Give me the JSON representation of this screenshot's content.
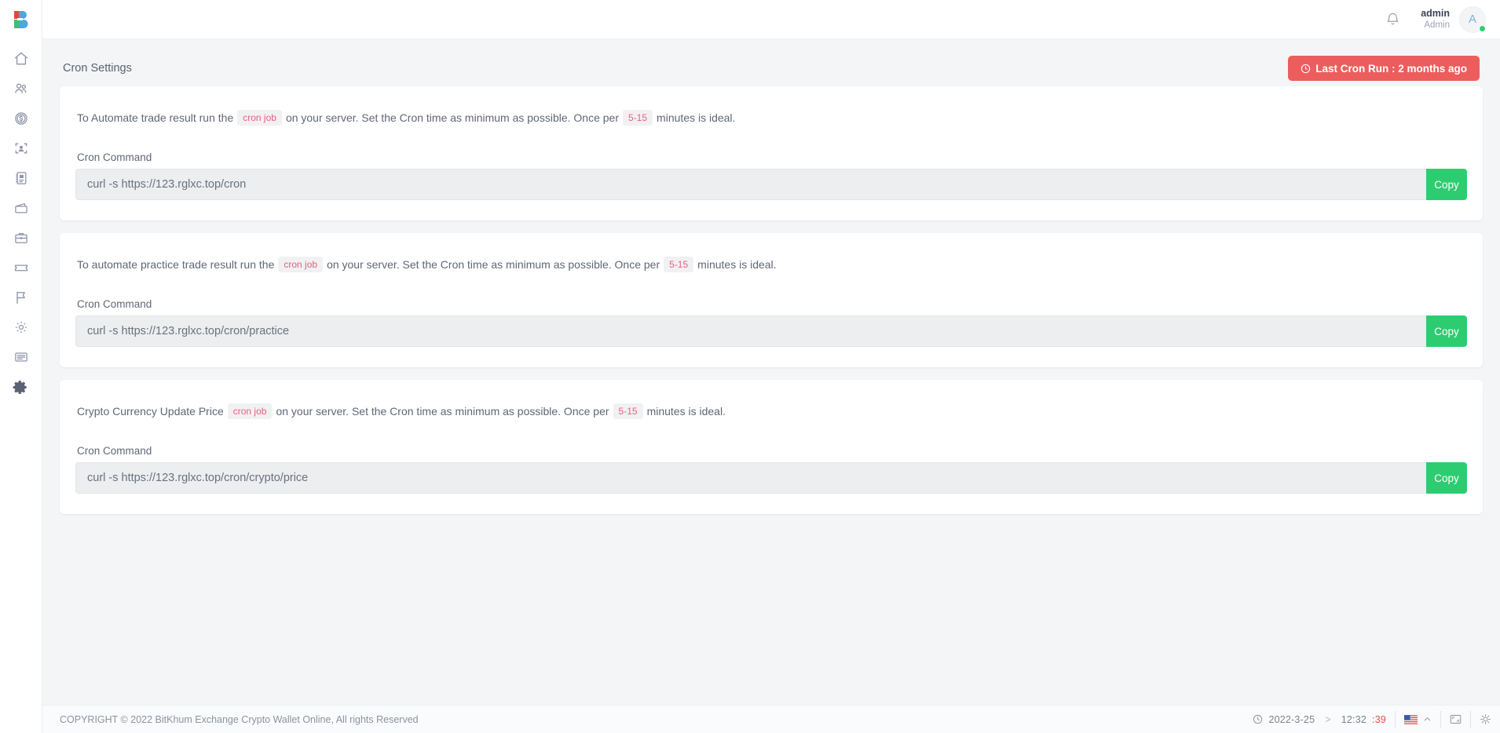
{
  "brand": {
    "logo_text": "B",
    "logo_colors": {
      "red": "#e8443f",
      "blue": "#4aa8e0",
      "green": "#3fbf6f"
    }
  },
  "sidebar": {
    "items": [
      {
        "icon": "home-icon",
        "label": "Dashboard"
      },
      {
        "icon": "users-icon",
        "label": "Users"
      },
      {
        "icon": "coin-dollar-icon",
        "label": "Finance"
      },
      {
        "icon": "kyc-identity-icon",
        "label": "KYC"
      },
      {
        "icon": "contact-book-icon",
        "label": "Contacts"
      },
      {
        "icon": "wallet-icon",
        "label": "Wallet"
      },
      {
        "icon": "briefcase-icon",
        "label": "Portfolio"
      },
      {
        "icon": "ticket-icon",
        "label": "Tickets"
      },
      {
        "icon": "flag-icon",
        "label": "Reports"
      },
      {
        "icon": "gear-outline-icon",
        "label": "Preferences"
      },
      {
        "icon": "document-lines-icon",
        "label": "Pages"
      },
      {
        "icon": "gear-solid-icon",
        "label": "Settings"
      }
    ]
  },
  "header": {
    "bell_icon": "bell-icon",
    "user_name": "admin",
    "user_role": "Admin",
    "avatar_initial": "A",
    "status": "online"
  },
  "page": {
    "title": "Cron Settings",
    "last_run_icon": "clock-icon",
    "last_run_label": "Last Cron Run : 2 months ago",
    "last_run_color": "#ec5d5d"
  },
  "cards": [
    {
      "desc_before": "To Automate trade result run the",
      "tag_job": "cron job",
      "desc_middle": "on your server. Set the Cron time as minimum as possible. Once per",
      "tag_minutes": "5-15",
      "desc_after": "minutes is ideal.",
      "field_label": "Cron Command",
      "command": "curl -s https://123.rglxc.top/cron",
      "copy_label": "Copy"
    },
    {
      "desc_before": "To automate practice trade result run the",
      "tag_job": "cron job",
      "desc_middle": "on your server. Set the Cron time as minimum as possible. Once per",
      "tag_minutes": "5-15",
      "desc_after": "minutes is ideal.",
      "field_label": "Cron Command",
      "command": "curl -s https://123.rglxc.top/cron/practice",
      "copy_label": "Copy"
    },
    {
      "desc_before": "Crypto Currency Update Price",
      "tag_job": "cron job",
      "desc_middle": "on your server. Set the Cron time as minimum as possible. Once per",
      "tag_minutes": "5-15",
      "desc_after": "minutes is ideal.",
      "field_label": "Cron Command",
      "command": "curl -s https://123.rglxc.top/cron/crypto/price",
      "copy_label": "Copy"
    }
  ],
  "footer": {
    "copyright": "COPYRIGHT © 2022 BitKhum Exchange Crypto Wallet Online, All rights Reserved",
    "tray": {
      "clock_icon": "clock-icon",
      "date": "2022-3-25",
      "separator": ">",
      "time_main": "12:32",
      "time_seconds": ":39",
      "seconds_color": "#e8514f",
      "flag_icon": "us-flag-icon",
      "caret_icon": "caret-up-icon",
      "screen_icon": "screen-icon",
      "brightness_icon": "brightness-icon"
    }
  }
}
